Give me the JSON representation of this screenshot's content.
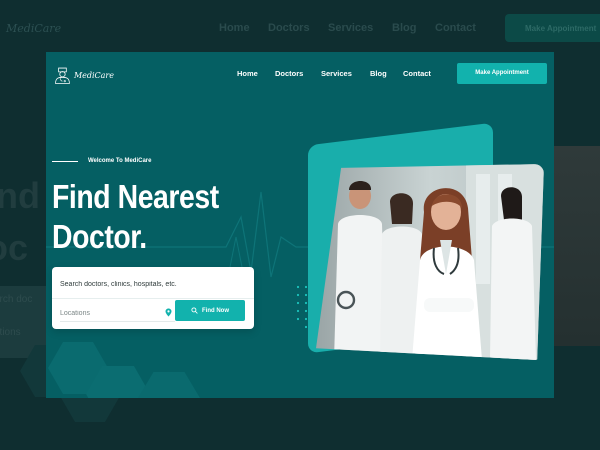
{
  "brand": {
    "name": "MediCare"
  },
  "nav": {
    "items": [
      {
        "label": "Home"
      },
      {
        "label": "Doctors"
      },
      {
        "label": "Services"
      },
      {
        "label": "Blog"
      },
      {
        "label": "Contact"
      }
    ],
    "cta_label": "Make Appointment"
  },
  "hero": {
    "eyebrow": "Welcome To MediCare",
    "title_line1": "Find Nearest",
    "title_line2": "Doctor.",
    "search_placeholder": "Search doctors, clinics, hospitals, etc.",
    "location_placeholder": "Locations",
    "find_button": "Find Now"
  },
  "background_page": {
    "nav_items": [
      "Home",
      "Doctors",
      "Services",
      "Blog",
      "Contact"
    ],
    "cta_label": "Make Appointment",
    "hero_fragment_1": "ind",
    "hero_fragment_2": "oc",
    "search_fragment": "arch doc",
    "location_fragment": "ations"
  },
  "colors": {
    "card_bg": "#055f63",
    "accent": "#12b2ad",
    "text_light": "#ffffff",
    "overlay": "#0f2e30"
  },
  "icons": [
    "doctor-logo-icon",
    "map-pin-icon",
    "search-icon"
  ]
}
